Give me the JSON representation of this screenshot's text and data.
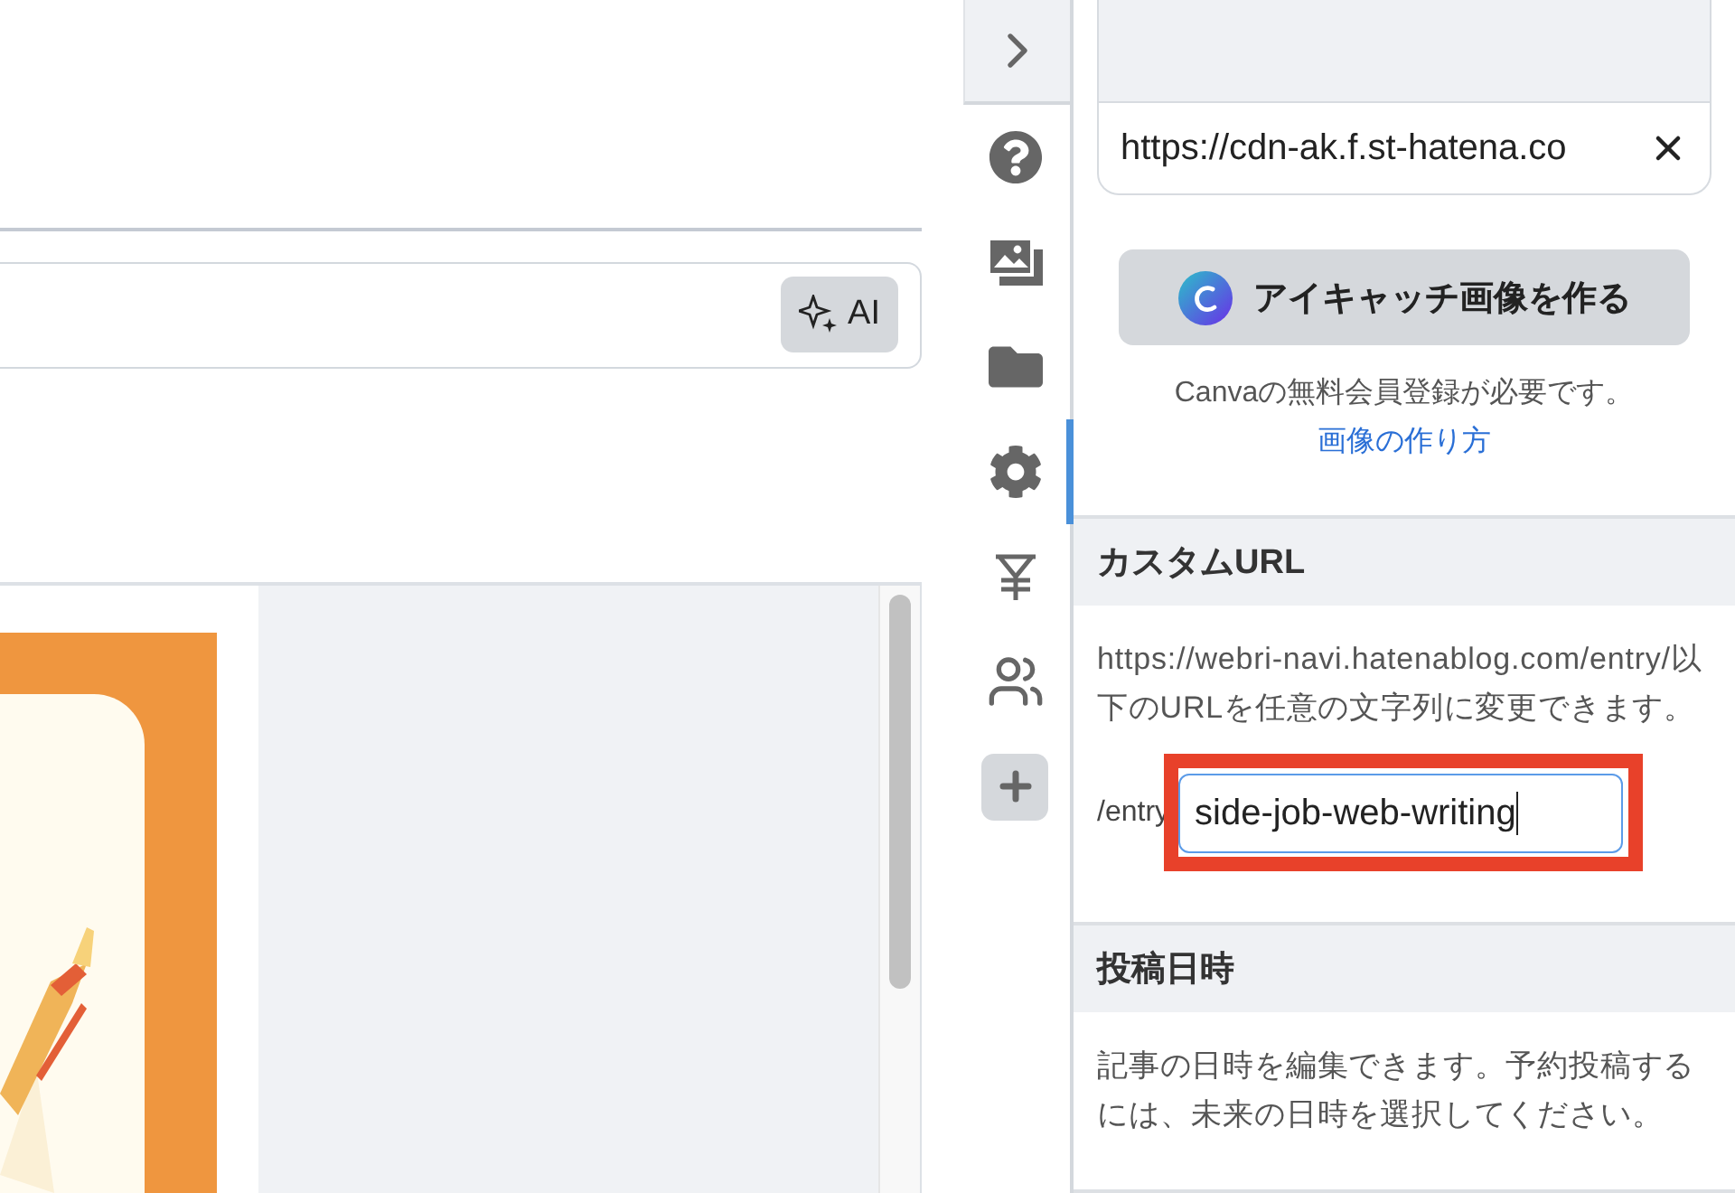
{
  "editor": {
    "ai_button": {
      "label": "AI"
    }
  },
  "sidebar": {
    "items": [
      {
        "kind": "tab",
        "selected": false
      },
      {
        "kind": "tab",
        "selected": false
      },
      {
        "kind": "tab",
        "selected": false
      },
      {
        "kind": "tab",
        "selected": true
      },
      {
        "kind": "tab",
        "selected": false
      },
      {
        "kind": "tab",
        "selected": false
      },
      {
        "kind": "button",
        "selected": false
      }
    ]
  },
  "panel": {
    "image_url": {
      "value": "https://cdn-ak.f.st-hatena.co"
    },
    "canva_button": {
      "label": "アイキャッチ画像を作る"
    },
    "canva_note": "Canvaの無料会員登録が必要です。",
    "canva_link": "画像の作り方",
    "sections": [
      {
        "title": "カスタムURL",
        "description": "https://webri-navi.hatenablog.com/entry/以下のURLを任意の文字列に変更できます。",
        "prefix": "/entry",
        "value": "side-job-web-writing",
        "highlighted": true
      },
      {
        "title": "投稿日時",
        "description": "記事の日時を編集できます。予約投稿するには、未来の日時を選択してください。"
      }
    ]
  }
}
